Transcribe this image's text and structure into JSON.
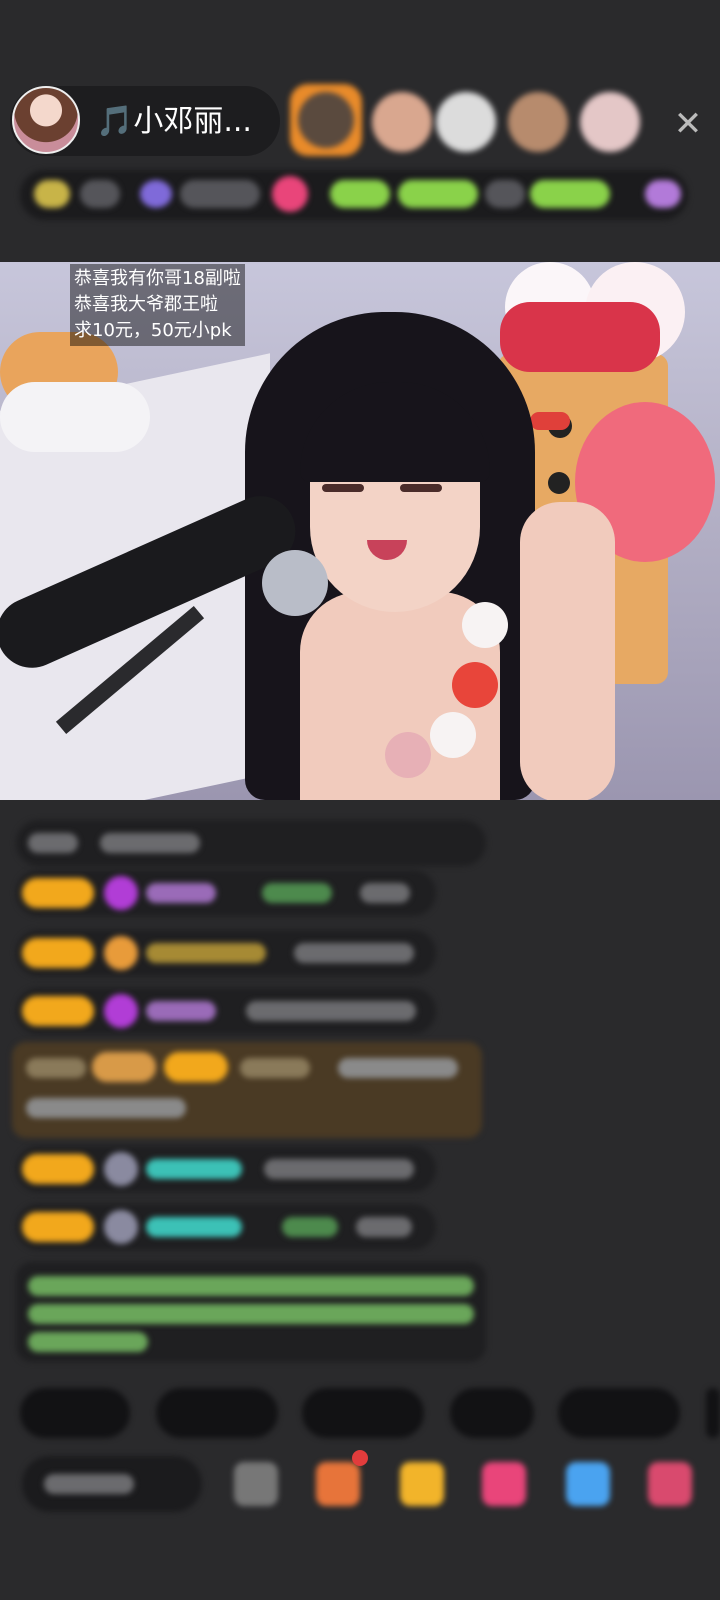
{
  "header": {
    "host_name": "🎵小邓丽...",
    "close_icon": "close-icon"
  },
  "video": {
    "caption_lines": [
      "恭喜我有你哥18副啦",
      "恭喜我大爷郡王啦",
      "求10元，50元小pk"
    ]
  },
  "colors": {
    "background": "#2a2a2c",
    "badge": "#f2a81c",
    "accent_pink": "#e9457a",
    "chat_green": "#7fd46a",
    "chat_teal": "#3cc1b6"
  }
}
